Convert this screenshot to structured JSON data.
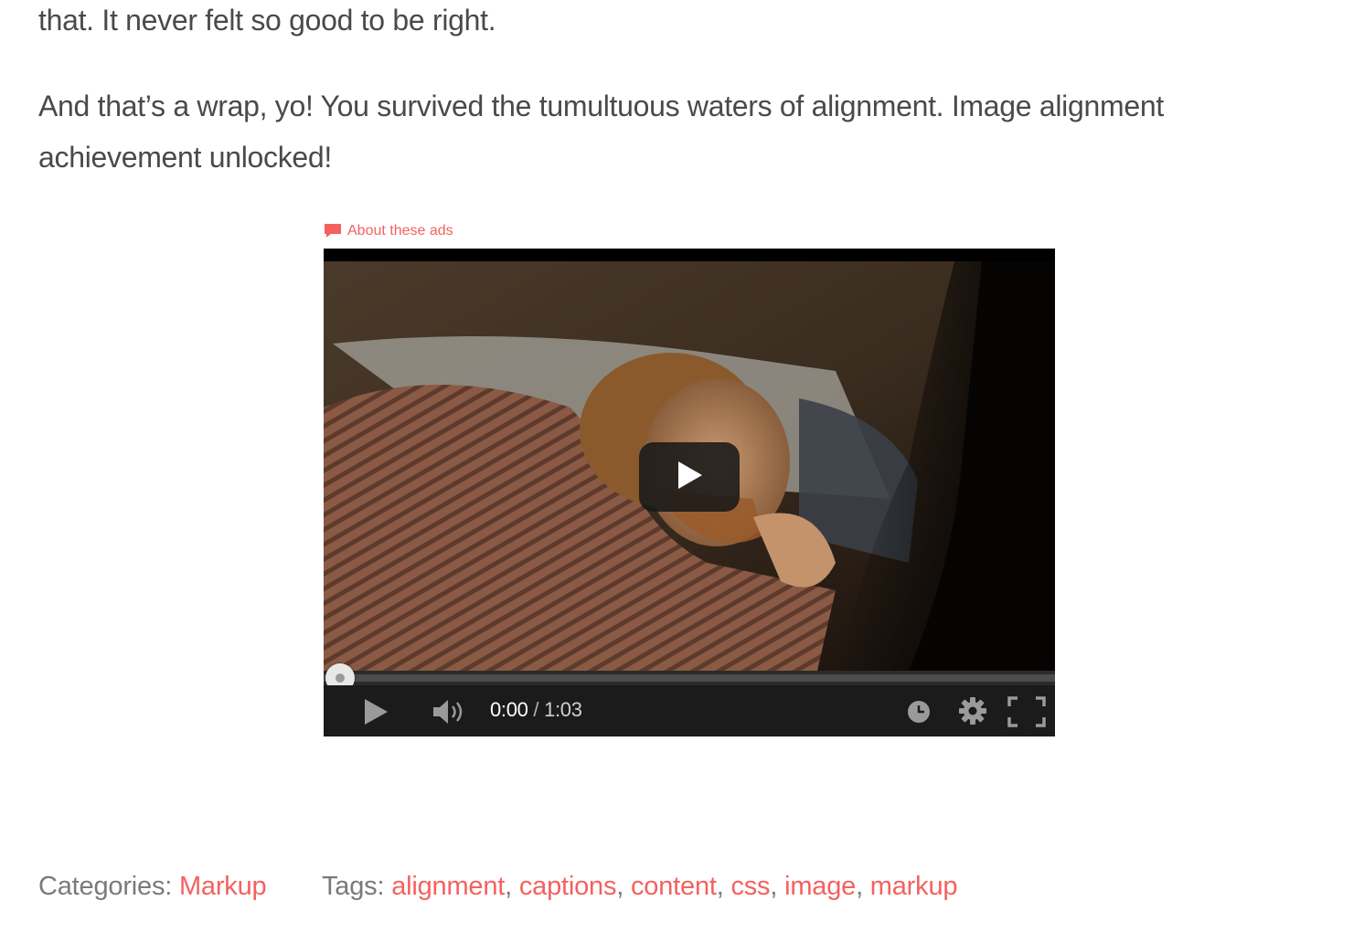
{
  "article": {
    "paragraph_1": "that. It never felt so good to be right.",
    "paragraph_2": "And that’s a wrap, yo! You survived the tumultuous waters of alignment. Image alignment achievement unlocked!"
  },
  "ads": {
    "label": "About these ads",
    "icon": "speech-bubble-icon"
  },
  "video_player": {
    "current_time": "0:00",
    "separator": " / ",
    "duration": "1:03",
    "progress": 0,
    "icons": {
      "big_play": "play-icon",
      "play": "play-icon",
      "volume": "volume-icon",
      "watch_later": "clock-icon",
      "settings": "gear-icon",
      "fullscreen": "fullscreen-icon"
    }
  },
  "footer_meta": {
    "categories_label": "Categories:",
    "categories": [
      "Markup"
    ],
    "tags_label": "Tags:",
    "tags": [
      "alignment",
      "captions",
      "content",
      "css",
      "image",
      "markup"
    ]
  },
  "colors": {
    "link": "#f4615f",
    "body_text": "#4a4a4a",
    "meta_text": "#7a7a7a"
  }
}
